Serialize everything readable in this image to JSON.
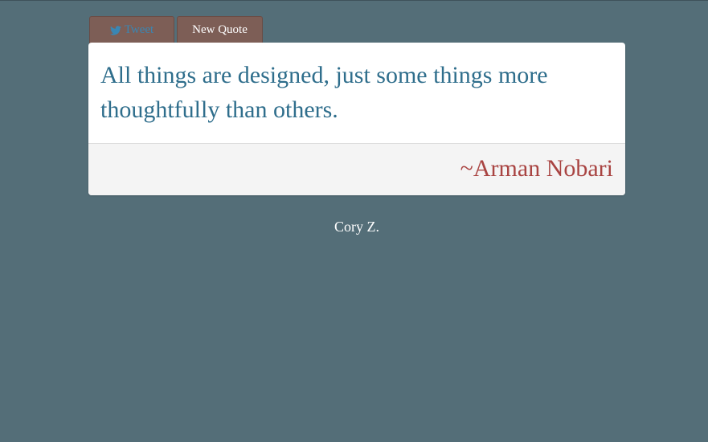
{
  "buttons": {
    "tweet_label": "Tweet",
    "tweet_icon": "twitter-bird-icon",
    "new_quote_label": "New Quote"
  },
  "quote": {
    "text": "All things are designed, just some things more thoughtfully than others.",
    "author": "~Arman Nobari"
  },
  "footer": {
    "credit": "Cory Z."
  },
  "colors": {
    "background": "#546e78",
    "button": "#7d5e56",
    "quote_text": "#2f6e8c",
    "author_text": "#a94442",
    "tweet_text": "#3a86b3"
  }
}
